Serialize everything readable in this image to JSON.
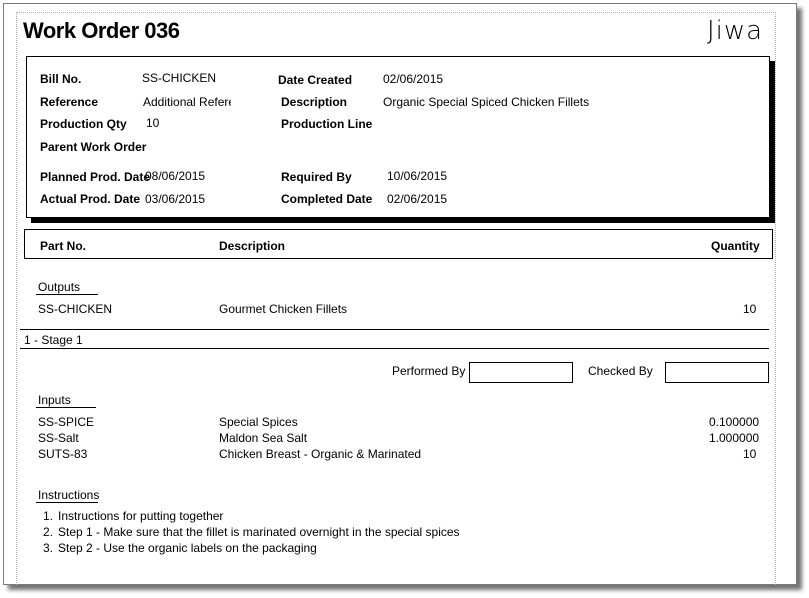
{
  "header": {
    "title": "Work Order 036",
    "logo": "Jiwa"
  },
  "details": {
    "bill_no_label": "Bill No.",
    "bill_no": "SS-CHICKEN",
    "date_created_label": "Date Created",
    "date_created": "02/06/2015",
    "reference_label": "Reference",
    "reference": "Additional Referen",
    "description_label": "Description",
    "description": "Organic Special Spiced Chicken Fillets",
    "production_qty_label": "Production Qty",
    "production_qty": "10",
    "production_line_label": "Production Line",
    "parent_wo_label": "Parent Work Order",
    "planned_date_label": "Planned Prod. Date",
    "planned_date": "08/06/2015",
    "required_by_label": "Required By",
    "required_by": "10/06/2015",
    "actual_date_label": "Actual Prod. Date",
    "actual_date": "03/06/2015",
    "completed_date_label": "Completed Date",
    "completed_date": "02/06/2015"
  },
  "columns": {
    "part_no": "Part No.",
    "description": "Description",
    "quantity": "Quantity"
  },
  "outputs": {
    "heading": "Outputs",
    "rows": [
      {
        "part": "SS-CHICKEN",
        "description": "Gourmet Chicken Fillets",
        "qty": "10"
      }
    ]
  },
  "stage": {
    "label": "1 - Stage 1",
    "performed_by_label": "Performed By",
    "checked_by_label": "Checked By"
  },
  "inputs": {
    "heading": "Inputs",
    "rows": [
      {
        "part": "SS-SPICE",
        "description": "Special Spices",
        "qty": "0.100000"
      },
      {
        "part": "SS-Salt",
        "description": "Maldon Sea Salt",
        "qty": "1.000000"
      },
      {
        "part": "SUTS-83",
        "description": "Chicken Breast - Organic & Marinated",
        "qty": "10"
      }
    ]
  },
  "instructions": {
    "heading": "Instructions",
    "items": [
      {
        "num": "1.",
        "text": "Instructions for putting together"
      },
      {
        "num": "2.",
        "text": "Step 1 - Make sure that the fillet is marinated overnight in the special spices"
      },
      {
        "num": "3.",
        "text": "Step 2 - Use the organic labels on the packaging"
      }
    ]
  }
}
